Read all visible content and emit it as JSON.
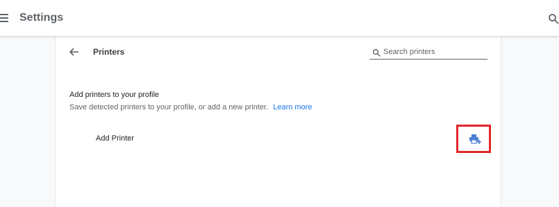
{
  "header": {
    "app_title": "Settings",
    "menu_icon": "hamburger-menu-icon",
    "search_icon": "search-icon"
  },
  "subpage": {
    "title": "Printers",
    "back_icon": "back-arrow-icon",
    "search": {
      "placeholder": "Search printers",
      "value": ""
    }
  },
  "section": {
    "heading": "Add printers to your profile",
    "description": "Save detected printers to your profile, or add a new printer.",
    "learn_more": "Learn more"
  },
  "add_printer": {
    "label": "Add Printer",
    "icon": "add-printer-icon"
  },
  "colors": {
    "accent": "#1a73e8",
    "highlight_border": "#e0262b",
    "icon_blue": "#4a7fd6"
  }
}
